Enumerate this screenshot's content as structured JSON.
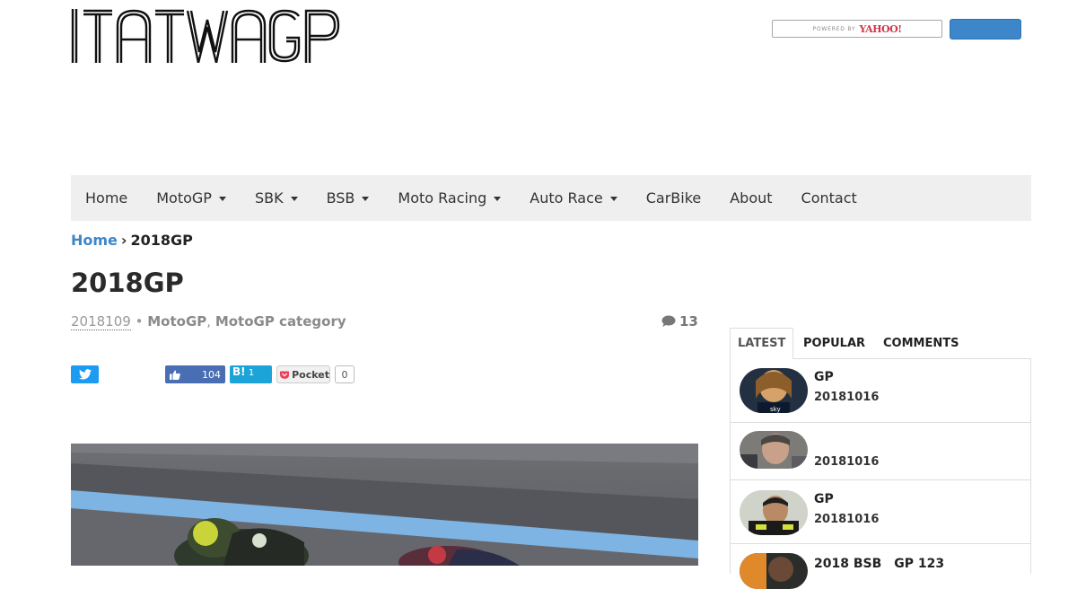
{
  "site": {
    "logo_text": "ITATWAGP"
  },
  "search": {
    "powered_by": "POWERED BY",
    "brand": "YAHOO!"
  },
  "nav": {
    "items": [
      {
        "label": "Home",
        "dropdown": false
      },
      {
        "label": "MotoGP",
        "dropdown": true
      },
      {
        "label": "SBK",
        "dropdown": true
      },
      {
        "label": "BSB",
        "dropdown": true
      },
      {
        "label": "Moto Racing",
        "dropdown": true
      },
      {
        "label": "Auto Race",
        "dropdown": true
      },
      {
        "label": "CarBike",
        "dropdown": false
      },
      {
        "label": "About",
        "dropdown": false
      },
      {
        "label": "Contact",
        "dropdown": false
      }
    ]
  },
  "breadcrumb": {
    "home": "Home",
    "separator": "›",
    "current": "2018GP"
  },
  "article": {
    "title": "2018GP",
    "date": "2018109",
    "bullet": "•",
    "category_1": "MotoGP",
    "comma": ",",
    "category_2": "MotoGP category",
    "comment_count": "13"
  },
  "share": {
    "like_count": "104",
    "hatena_label": "B!",
    "hatena_count": "1",
    "pocket_label": "Pocket",
    "pocket_count": "0"
  },
  "sidebar": {
    "tabs": [
      "LATEST",
      "POPULAR",
      "COMMENTS"
    ],
    "posts": [
      {
        "title": "GP",
        "date": "20181016"
      },
      {
        "title": "",
        "date": "20181016"
      },
      {
        "title": "GP",
        "date": "20181016"
      },
      {
        "title": "2018 BSB　GP 123",
        "date": ""
      }
    ]
  },
  "colors": {
    "accent": "#3d86c9",
    "nav_bg": "#efefef",
    "twitter": "#1d9bf0",
    "facebook": "#4a6eb4",
    "hatena": "#1ca4d9"
  },
  "icons": [
    "twitter-icon",
    "thumbs-up-icon",
    "pocket-icon",
    "comment-icon",
    "caret-down-icon"
  ]
}
